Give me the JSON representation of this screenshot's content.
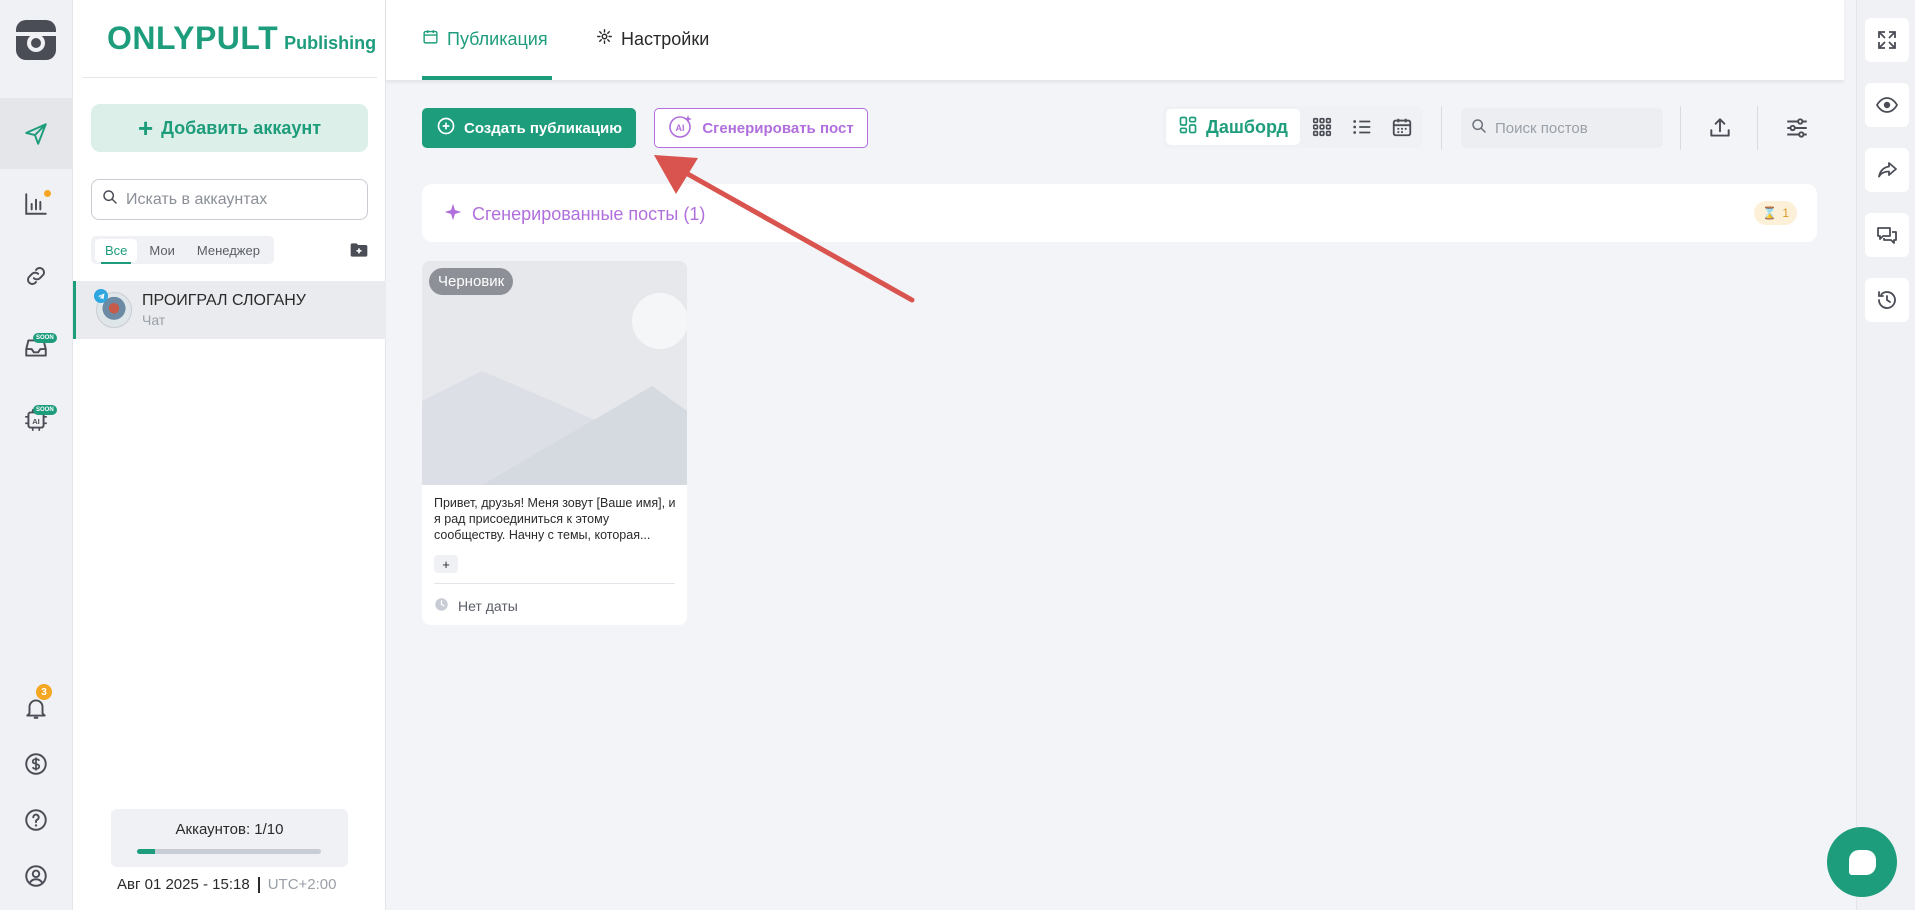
{
  "brand": {
    "name": "ONLYPULT",
    "sub": "Publishing",
    "color": "#1e9d7c"
  },
  "sidebar": {
    "add_account_label": "Добавить аккаунт",
    "search_placeholder": "Искать в аккаунтах",
    "filter_tabs": [
      {
        "label": "Все",
        "active": true
      },
      {
        "label": "Мои",
        "active": false
      },
      {
        "label": "Менеджер",
        "active": false
      }
    ],
    "accounts": [
      {
        "name": "ПРОИГРАЛ СЛОГАНУ",
        "type": "Чат",
        "network": "telegram"
      }
    ],
    "account_count": "Аккаунтов: 1/10",
    "account_usage_fraction": 0.1,
    "datetime": "Авг 01 2025 - 15:18",
    "timezone": "UTC+2:00"
  },
  "rail": {
    "items": [
      {
        "icon": "paper-plane-icon",
        "active": true
      },
      {
        "icon": "analytics-icon",
        "has_dot": true
      },
      {
        "icon": "link-icon"
      },
      {
        "icon": "inbox-icon",
        "badge": "SOON"
      },
      {
        "icon": "ai-chip-icon",
        "badge": "SOON"
      }
    ],
    "bottom": [
      {
        "icon": "bell-icon",
        "count": "3"
      },
      {
        "icon": "dollar-icon"
      },
      {
        "icon": "help-icon"
      },
      {
        "icon": "profile-icon"
      }
    ]
  },
  "header": {
    "tabs": [
      {
        "label": "Публикация",
        "icon": "calendar-icon",
        "active": true
      },
      {
        "label": "Настройки",
        "icon": "gear-icon",
        "active": false
      }
    ]
  },
  "toolbar": {
    "create_label": "Создать публикацию",
    "generate_label": "Сгенерировать пост",
    "view_dashboard_label": "Дашборд",
    "views": [
      "dashboard-icon",
      "grid-icon",
      "list-icon",
      "calendar-icon"
    ],
    "search_placeholder": "Поиск постов"
  },
  "generated": {
    "title": "Сгенерированные посты (1)",
    "badge_count": "1"
  },
  "posts": [
    {
      "status": "Черновик",
      "text": "Привет, друзья! Меня зовут [Ваше имя], и я рад присоединиться к этому сообществу. Начну с темы, которая...",
      "add_label": "+",
      "date": "Нет даты"
    }
  ],
  "colors": {
    "accent": "#1e9d7c",
    "ai": "#b06fdc",
    "annotation_arrow": "#d9534f"
  }
}
